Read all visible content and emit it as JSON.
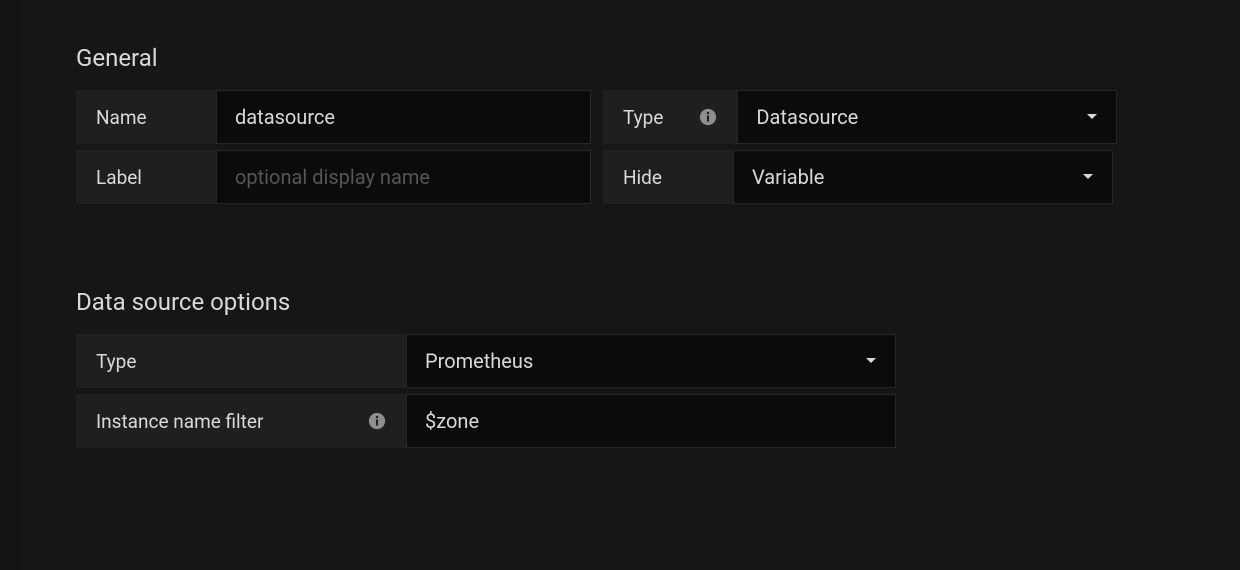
{
  "general": {
    "heading": "General",
    "name_label": "Name",
    "name_value": "datasource",
    "type_label": "Type",
    "type_value": "Datasource",
    "label_label": "Label",
    "label_placeholder": "optional display name",
    "label_value": "",
    "hide_label": "Hide",
    "hide_value": "Variable"
  },
  "ds_options": {
    "heading": "Data source options",
    "type_label": "Type",
    "type_value": "Prometheus",
    "filter_label": "Instance name filter",
    "filter_value": "$zone"
  }
}
